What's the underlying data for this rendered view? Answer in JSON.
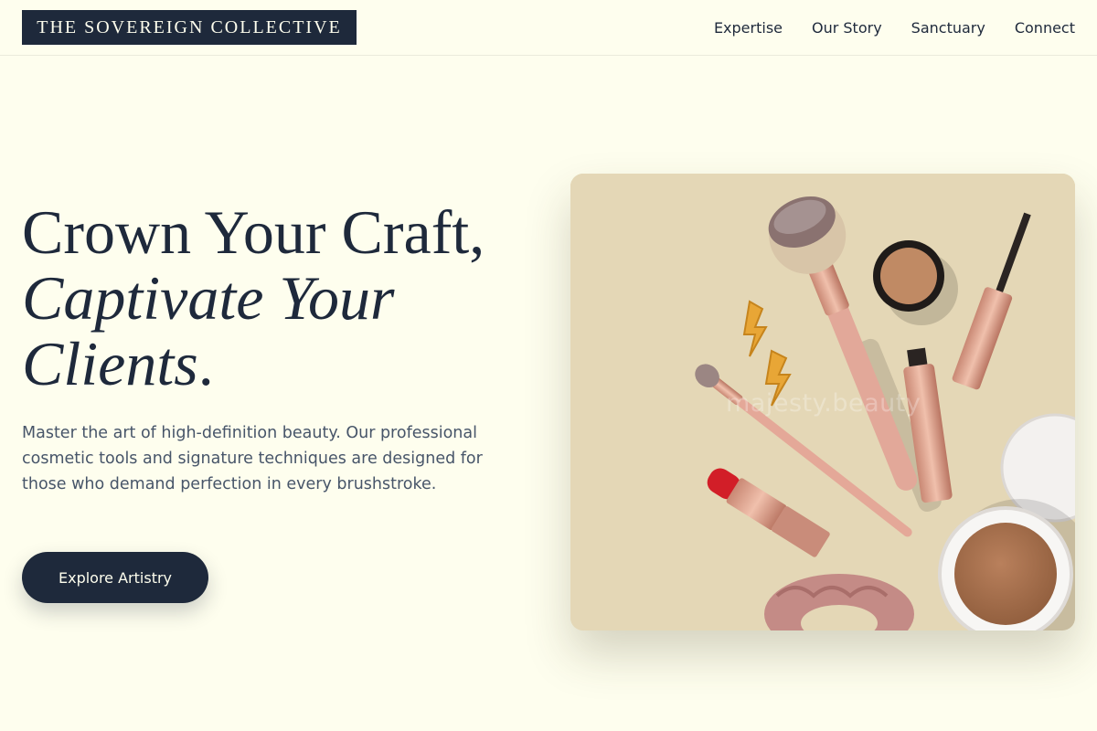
{
  "header": {
    "logo_text": "THE SOVEREIGN COLLECTIVE",
    "nav": [
      {
        "label": "Expertise"
      },
      {
        "label": "Our Story"
      },
      {
        "label": "Sanctuary"
      },
      {
        "label": "Connect"
      }
    ]
  },
  "hero": {
    "headline_line1": "Crown Your Craft,",
    "headline_line2": "Captivate Your",
    "headline_line3_word": "Clients",
    "headline_line3_punct": ".",
    "description": "Master the art of high-definition beauty. Our professional cosmetic tools and signature techniques are designed for those who demand perfection in every brushstroke.",
    "cta_label": "Explore Artistry",
    "image": {
      "subject": "flat lay of pink cosmetic brushes, lipstick, mascara, compact powder, scrunchie and lightning earrings",
      "watermark": "majesty.beauty"
    }
  },
  "colors": {
    "background": "#fefeee",
    "primary": "#1e293b",
    "body_text": "#475569",
    "image_bg": "#e4d7b6",
    "rose_gold": "#dba08c"
  }
}
